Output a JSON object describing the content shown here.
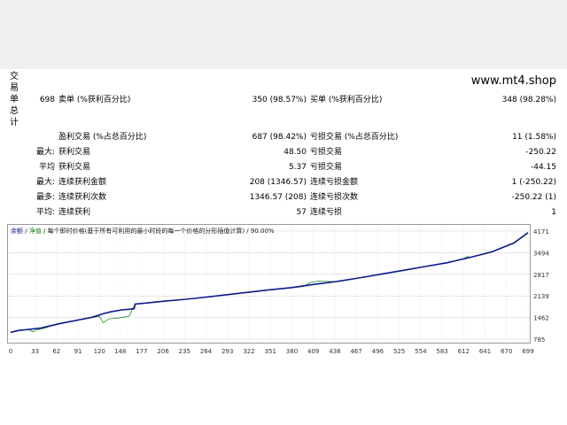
{
  "watermark": "www.mt4.shop",
  "side_title": [
    "交",
    "易",
    "单",
    "总",
    "计"
  ],
  "rows": [
    {
      "c1": "",
      "c2": "698",
      "c3": "卖单 (%获利百分比)",
      "c4": "350 (98.57%)",
      "c5": "买单 (%获利百分比)",
      "c6": "348 (98.28%)"
    },
    {
      "c1": "",
      "c2": "",
      "c3": "盈利交易 (%占总百分比)",
      "c4": "687 (98.42%)",
      "c5": "亏损交易 (%占总百分比)",
      "c6": "11 (1.58%)"
    },
    {
      "c1": "最大:",
      "c2": "",
      "c3": "获利交易",
      "c4": "48.50",
      "c5": "亏损交易",
      "c6": "-250.22"
    },
    {
      "c1": "平均",
      "c2": "",
      "c3": "获利交易",
      "c4": "5.37",
      "c5": "亏损交易",
      "c6": "-44.15"
    },
    {
      "c1": "最大:",
      "c2": "",
      "c3": "连续获利金额",
      "c4": "208 (1346.57)",
      "c5": "连续亏损金额",
      "c6": "1 (-250.22)"
    },
    {
      "c1": "最多:",
      "c2": "",
      "c3": "连续获利次数",
      "c4": "1346.57 (208)",
      "c5": "连续亏损次数",
      "c6": "-250.22 (1)"
    },
    {
      "c1": "平均:",
      "c2": "",
      "c3": "连续获利",
      "c4": "57",
      "c5": "连续亏损",
      "c6": "1"
    }
  ],
  "legend": {
    "balance": "余额",
    "sep1": " / ",
    "equity": "净值",
    "rest": " / 每个即时价格(基于所有可利用的最小时段的每一个价格的分形插值计算) / 90.00%"
  },
  "colors": {
    "balance": "#0b1a8a",
    "equity": "#1a8a1a",
    "grid": "#d0d0d0"
  },
  "chart_data": {
    "type": "line",
    "x_ticks": [
      "0",
      "33",
      "62",
      "91",
      "120",
      "148",
      "177",
      "206",
      "235",
      "264",
      "293",
      "322",
      "351",
      "380",
      "409",
      "438",
      "467",
      "496",
      "525",
      "554",
      "583",
      "612",
      "641",
      "670",
      "699"
    ],
    "y_ticks": [
      "4171",
      "3494",
      "2817",
      "2139",
      "1462",
      "785"
    ],
    "ylim": [
      785,
      4171
    ],
    "xlim": [
      0,
      699
    ],
    "series": [
      {
        "points": [
          [
            0,
            1000
          ],
          [
            12,
            1060
          ],
          [
            25,
            1090
          ],
          [
            40,
            1130
          ],
          [
            55,
            1210
          ],
          [
            70,
            1290
          ],
          [
            90,
            1380
          ],
          [
            110,
            1470
          ],
          [
            125,
            1580
          ],
          [
            135,
            1640
          ],
          [
            150,
            1700
          ],
          [
            160,
            1720
          ],
          [
            167,
            1740
          ],
          [
            168,
            1880
          ],
          [
            185,
            1920
          ],
          [
            210,
            1980
          ],
          [
            230,
            2020
          ],
          [
            260,
            2090
          ],
          [
            290,
            2170
          ],
          [
            320,
            2250
          ],
          [
            350,
            2330
          ],
          [
            380,
            2400
          ],
          [
            410,
            2500
          ],
          [
            440,
            2590
          ],
          [
            470,
            2700
          ],
          [
            500,
            2820
          ],
          [
            530,
            2940
          ],
          [
            560,
            3060
          ],
          [
            590,
            3180
          ],
          [
            620,
            3340
          ],
          [
            650,
            3520
          ],
          [
            680,
            3800
          ],
          [
            699,
            4120
          ]
        ]
      },
      {
        "points": [
          [
            0,
            1000
          ],
          [
            12,
            1060
          ],
          [
            25,
            1080
          ],
          [
            30,
            1010
          ],
          [
            33,
            1060
          ],
          [
            45,
            1120
          ],
          [
            55,
            1200
          ],
          [
            70,
            1280
          ],
          [
            90,
            1370
          ],
          [
            110,
            1460
          ],
          [
            120,
            1500
          ],
          [
            125,
            1300
          ],
          [
            133,
            1420
          ],
          [
            150,
            1460
          ],
          [
            160,
            1500
          ],
          [
            168,
            1880
          ],
          [
            185,
            1920
          ],
          [
            210,
            1980
          ],
          [
            230,
            2020
          ],
          [
            260,
            2090
          ],
          [
            290,
            2170
          ],
          [
            320,
            2250
          ],
          [
            350,
            2330
          ],
          [
            380,
            2400
          ],
          [
            395,
            2430
          ],
          [
            405,
            2560
          ],
          [
            415,
            2600
          ],
          [
            440,
            2590
          ],
          [
            470,
            2700
          ],
          [
            500,
            2820
          ],
          [
            530,
            2940
          ],
          [
            560,
            3060
          ],
          [
            590,
            3180
          ],
          [
            610,
            3290
          ],
          [
            618,
            3380
          ],
          [
            620,
            3340
          ],
          [
            650,
            3520
          ],
          [
            680,
            3800
          ],
          [
            699,
            4120
          ]
        ]
      }
    ]
  }
}
